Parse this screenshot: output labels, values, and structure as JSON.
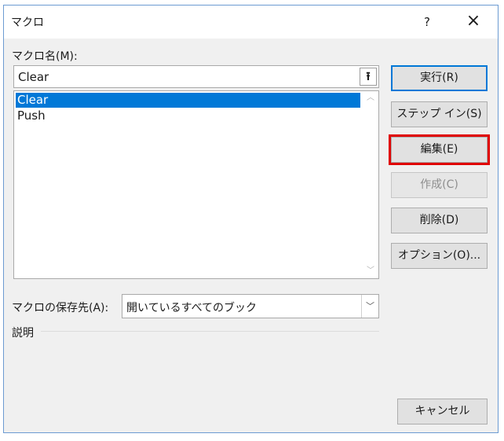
{
  "window": {
    "title": "マクロ",
    "help": "?",
    "close": "×"
  },
  "macro_name": {
    "label": "マクロ名(M):",
    "value": "Clear"
  },
  "macro_list": {
    "items": [
      "Clear",
      "Push"
    ],
    "selected_index": 0
  },
  "buttons": {
    "run": "実行(R)",
    "step_in": "ステップ イン(S)",
    "edit": "編集(E)",
    "create": "作成(C)",
    "delete": "削除(D)",
    "options": "オプション(O)...",
    "cancel": "キャンセル"
  },
  "location": {
    "label": "マクロの保存先(A):",
    "value": "開いているすべてのブック"
  },
  "description": {
    "label": "説明"
  },
  "colors": {
    "selection": "#0078d7",
    "highlight_box": "#e00000"
  }
}
